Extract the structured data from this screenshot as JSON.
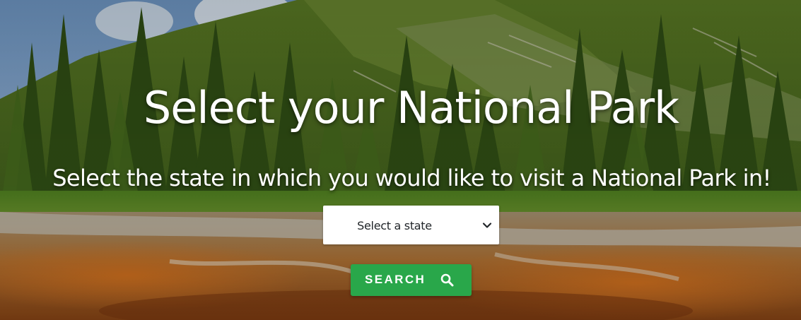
{
  "hero": {
    "title": "Select your National Park",
    "subtitle": "Select the state in which you would like to visit a National Park in!",
    "state_select": {
      "selected": "Select a state",
      "icon": "chevron-down-icon"
    },
    "search_button": {
      "label": "SEARCH",
      "icon": "search-icon"
    }
  },
  "colors": {
    "button": "#29a74a",
    "title_text": "#ffffff",
    "select_bg": "#ffffff"
  }
}
